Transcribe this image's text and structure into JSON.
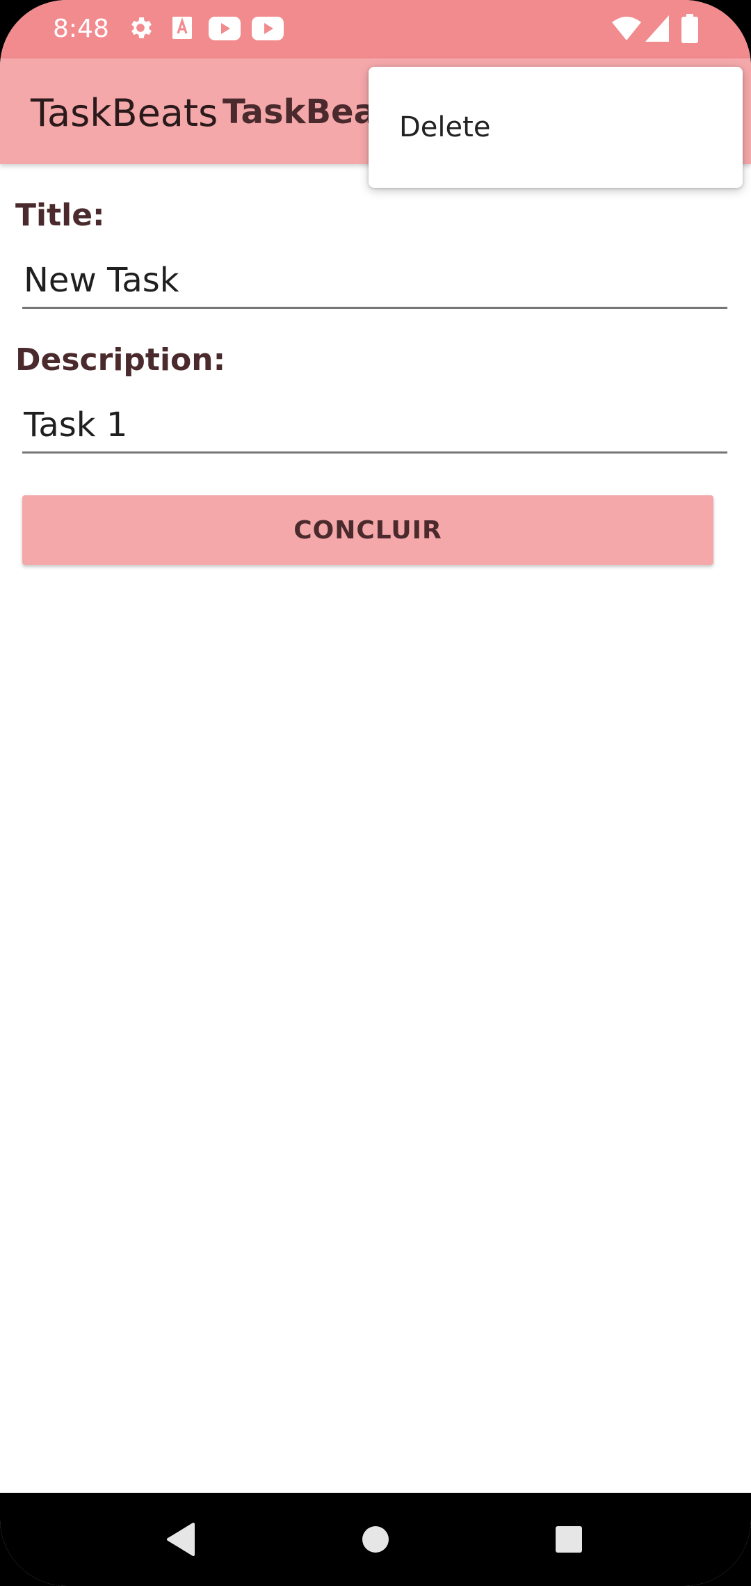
{
  "status_bar": {
    "time": "8:48",
    "icons_left": [
      "settings-icon",
      "font-app-icon",
      "youtube-icon",
      "youtube-icon"
    ],
    "icons_right": [
      "wifi-icon",
      "cellular-signal-icon",
      "battery-icon"
    ],
    "background": "#f28b8e"
  },
  "app_bar": {
    "title": "TaskBeats",
    "subtitle": "TaskBeats",
    "background": "#f4a8aa"
  },
  "menu": {
    "items": [
      {
        "label": "Delete"
      }
    ]
  },
  "form": {
    "title_label": "Title:",
    "title_value": "New Task",
    "description_label": "Description:",
    "description_value": "Task 1",
    "conclude_button": "CONCLUIR"
  },
  "nav_bar": {
    "buttons": [
      "back-icon",
      "home-icon",
      "recents-icon"
    ]
  },
  "colors": {
    "accent": "#f4a8aa",
    "text_dark": "#4a2a2c"
  }
}
